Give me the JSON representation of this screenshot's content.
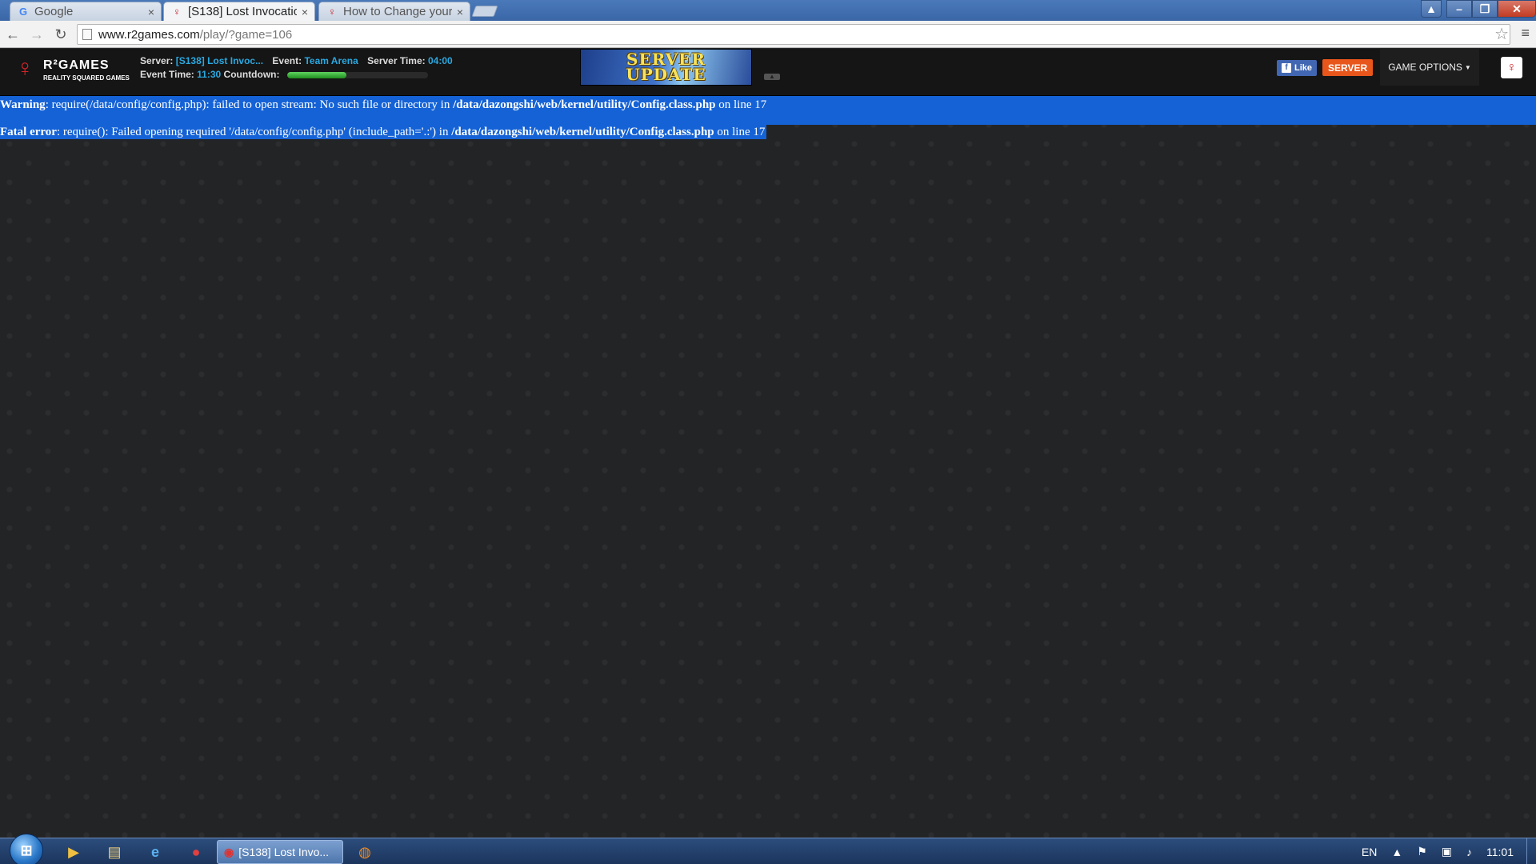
{
  "browser": {
    "tabs": [
      {
        "label": "Google",
        "icon": "google-icon",
        "active": false
      },
      {
        "label": "[S138] Lost Invocatio",
        "icon": "r2games-icon",
        "active": true
      },
      {
        "label": "How to Change your",
        "icon": "r2games-icon",
        "active": false
      }
    ],
    "close_glyph": "×",
    "address": {
      "host": "www.r2games.com",
      "path": "/play/?game=106"
    }
  },
  "game_header": {
    "logo_brand": "R²GAMES",
    "logo_tagline": "REALITY SQUARED GAMES",
    "server_label": "Server:",
    "server_value": "[S138] Lost Invoc...",
    "event_label": "Event:",
    "event_value": "Team Arena",
    "server_time_label": "Server Time:",
    "server_time_value": "04:00",
    "event_time_label": "Event Time:",
    "event_time_value": "11:30",
    "countdown_label": "Countdown:",
    "countdown_progress": 0.42,
    "banner_line1": "SERVER",
    "banner_line2": "UPDATE",
    "fb_like_label": "Like",
    "server_button": "SERVER",
    "game_options_button": "GAME OPTIONS"
  },
  "errors": {
    "warning_label": "Warning",
    "warning_text": ": require(/data/config/config.php): failed to open stream: No such file or directory in ",
    "warning_file": "/data/dazongshi/web/kernel/utility/Config.class.php",
    "warning_suffix": " on line ",
    "warning_line": "17",
    "fatal_label": "Fatal error",
    "fatal_text": ": require(): Failed opening required '/data/config/config.php' (include_path='.:') in ",
    "fatal_file": "/data/dazongshi/web/kernel/utility/Config.class.php",
    "fatal_suffix": " on line ",
    "fatal_line": "17"
  },
  "taskbar": {
    "active_task": "[S138] Lost Invo...",
    "language": "EN",
    "clock": "11:01"
  }
}
